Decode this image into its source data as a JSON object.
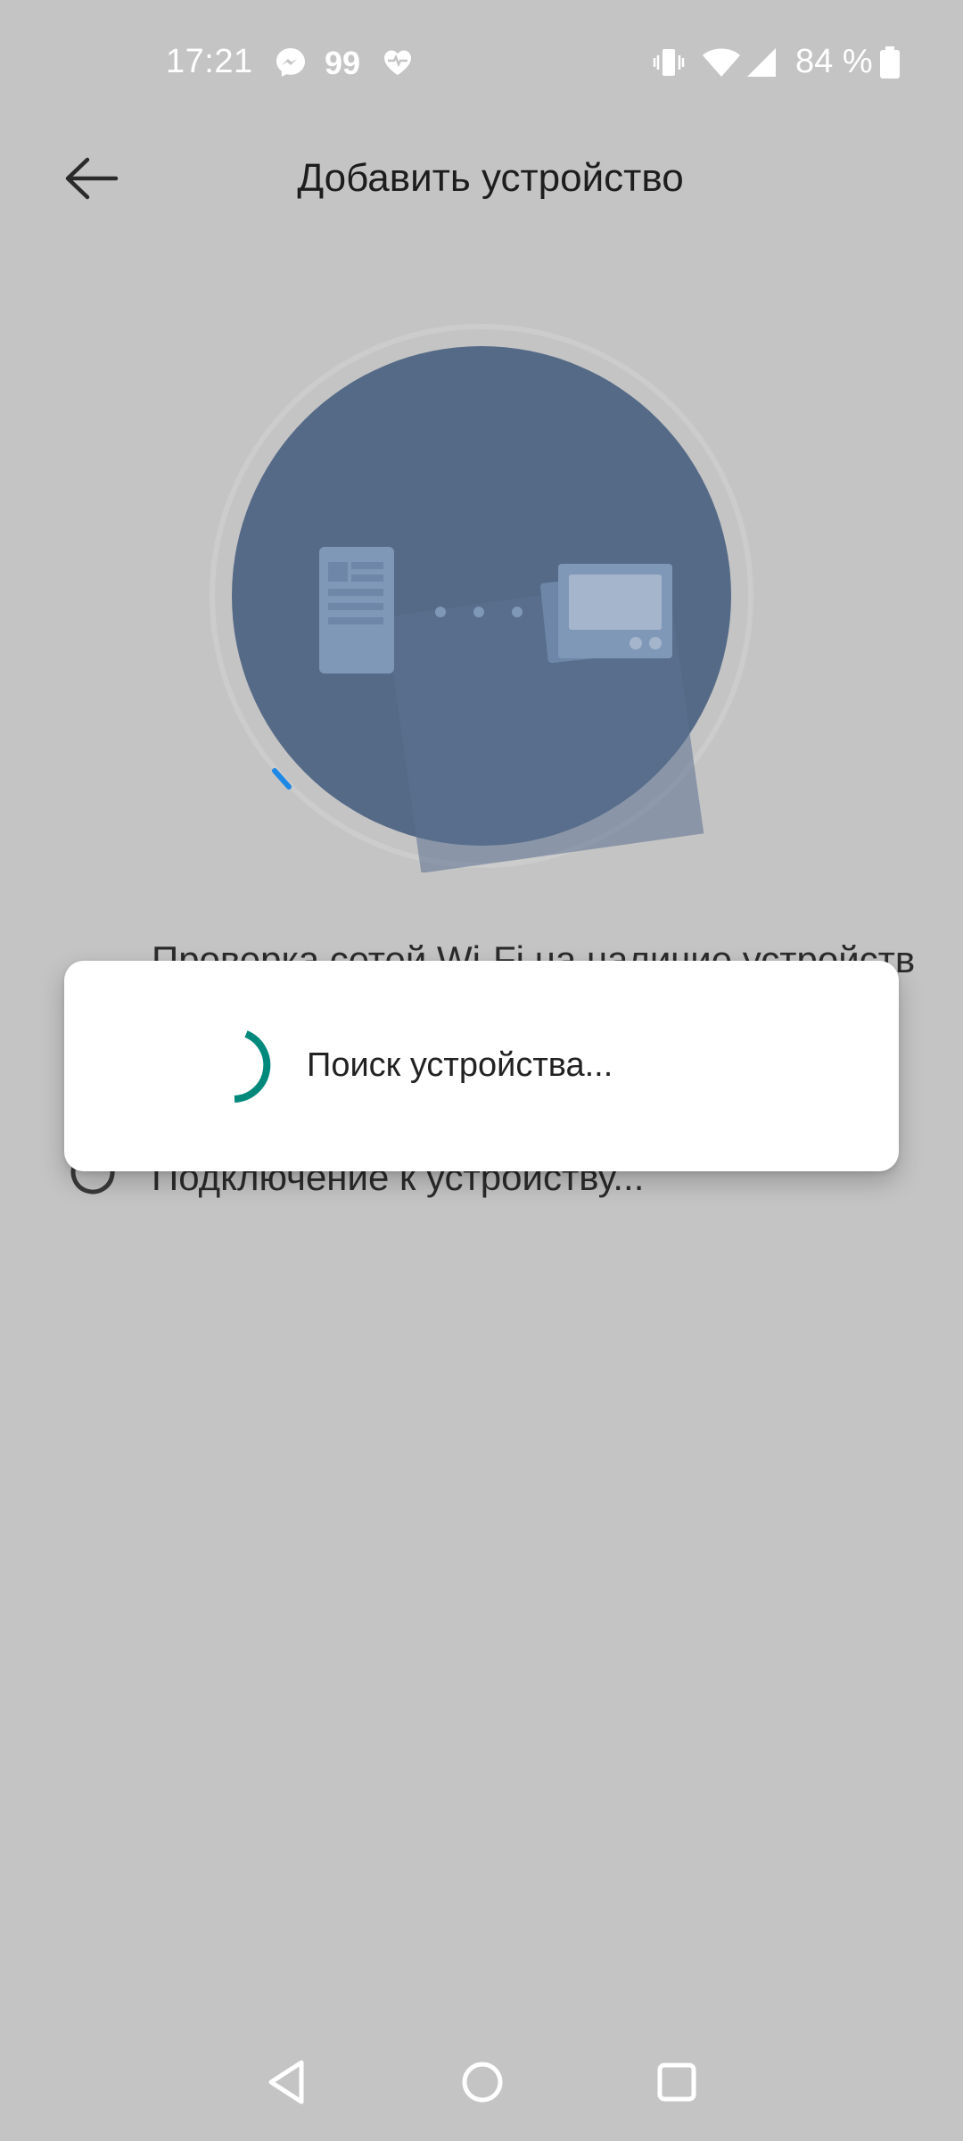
{
  "status_bar": {
    "time": "17:21",
    "notification_count": "99",
    "battery_percent": "84 %",
    "icons": [
      "messenger-icon",
      "health-heart-icon",
      "vibrate-icon",
      "wifi-icon",
      "signal-icon",
      "battery-icon"
    ]
  },
  "header": {
    "title": "Добавить устройство",
    "back_icon": "arrow-left-icon"
  },
  "illustration": {
    "icons": [
      "phone-icon",
      "connection-dots-icon",
      "device-icon"
    ],
    "colors": {
      "circle": "#546a87",
      "ring": "#c9c9c9",
      "progress": "#1e88e5"
    }
  },
  "background_steps": {
    "step1_label": "Проверка сетей Wi-Fi на наличие устройств",
    "step2_label": "Подключение к устройству..."
  },
  "dialog": {
    "message": "Поиск устройства...",
    "spinner_color": "#00897b"
  },
  "nav_bar": {
    "back_icon": "nav-back-icon",
    "home_icon": "nav-home-icon",
    "recents_icon": "nav-recents-icon"
  }
}
